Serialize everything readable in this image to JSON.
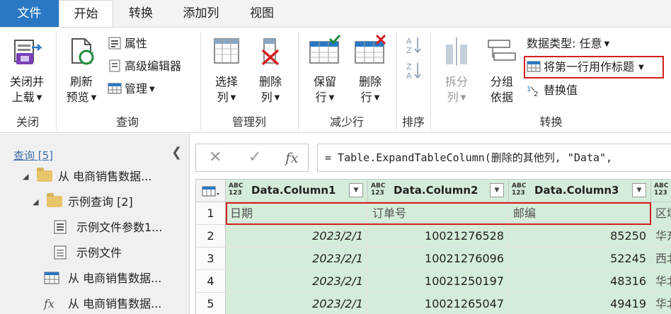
{
  "tabs": [
    "文件",
    "开始",
    "转换",
    "添加列",
    "视图"
  ],
  "groups": {
    "close": "关闭",
    "query": "查询",
    "manage_columns": "管理列",
    "reduce_rows": "减少行",
    "sort": "排序",
    "transform": "转换"
  },
  "buttons": {
    "close_load": "关闭并\n上载",
    "refresh_preview": "刷新\n预览",
    "properties": "属性",
    "advanced_editor": "高级编辑器",
    "manage": "管理",
    "choose_columns": "选择\n列",
    "remove_columns": "删除\n列",
    "keep_rows": "保留\n行",
    "remove_rows": "删除\n行",
    "split_column": "拆分\n列",
    "group_by": "分组\n依据",
    "data_type": "数据类型: 任意",
    "use_first_row": "将第一行用作标题",
    "replace_values": "替换值"
  },
  "nav": {
    "header": "查询 [5]",
    "items": [
      "从 电商销售数据...",
      "示例查询 [2]",
      "示例文件参数1...",
      "示例文件",
      "从 电商销售数据...",
      "从 电商销售数据..."
    ]
  },
  "formula": {
    "text": "= Table.ExpandTableColumn(删除的其他列, \"Data\","
  },
  "grid": {
    "type_label_top": "ABC",
    "type_label_bottom": "123",
    "columns": [
      "Data.Column1",
      "Data.Column2",
      "Data.Column3"
    ],
    "row_numbers": [
      "1",
      "2",
      "3",
      "4",
      "5"
    ],
    "rows": [
      [
        "日期",
        "订单号",
        "邮编",
        "区域"
      ],
      [
        "2023/2/1",
        "10021276528",
        "85250",
        "华东"
      ],
      [
        "2023/2/1",
        "10021276096",
        "52245",
        "西北"
      ],
      [
        "2023/2/1",
        "10021250197",
        "48316",
        "华北"
      ],
      [
        "2023/2/1",
        "10021265047",
        "49419",
        "华北"
      ]
    ]
  }
}
